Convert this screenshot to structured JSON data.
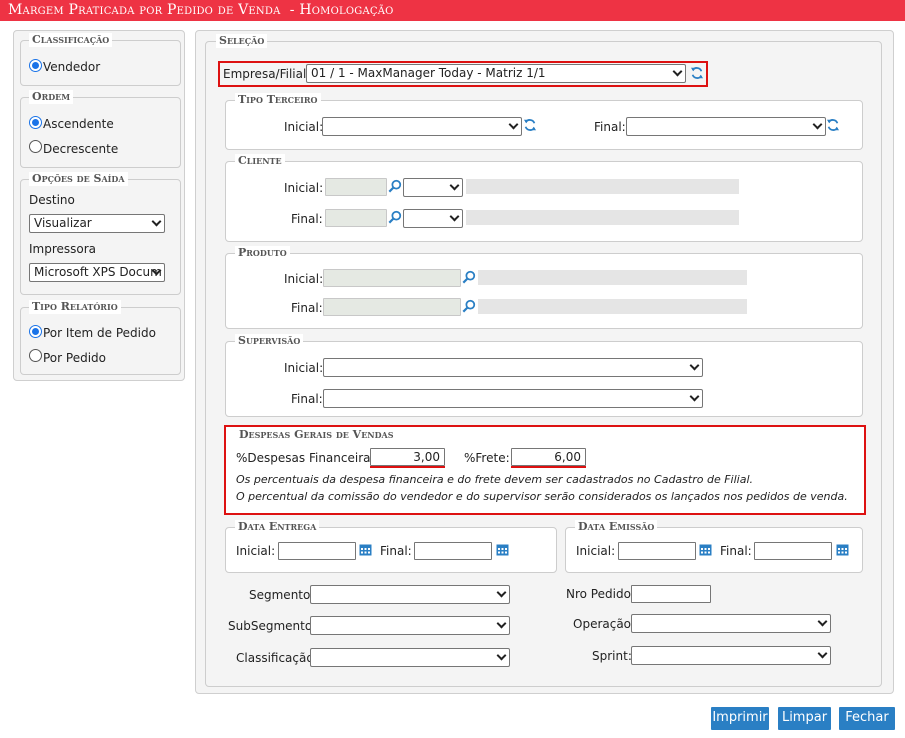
{
  "window": {
    "title": "Margem Praticada por Pedido de Venda  - Homologação"
  },
  "left": {
    "classificacao": {
      "legend": "Classificação",
      "options": [
        "Vendedor"
      ]
    },
    "ordem": {
      "legend": "Ordem",
      "options": [
        "Ascendente",
        "Decrescente"
      ]
    },
    "saida": {
      "legend": "Opções de Saída",
      "destino_label": "Destino",
      "destino_value": "Visualizar",
      "impressora_label": "Impressora",
      "impressora_value": "Microsoft XPS Docum"
    },
    "tipo": {
      "legend": "Tipo Relatório",
      "options": [
        "Por Item de Pedido",
        "Por Pedido"
      ]
    }
  },
  "selecao": {
    "legend": "Seleção",
    "empresa_label": "Empresa/Filial:",
    "empresa_value": "01 / 1 - MaxManager Today - Matriz 1/1",
    "tipo_terceiro": {
      "legend": "Tipo Terceiro",
      "inicial": "Inicial:",
      "final": "Final:"
    },
    "cliente": {
      "legend": "Cliente",
      "inicial": "Inicial:",
      "final": "Final:"
    },
    "produto": {
      "legend": "Produto",
      "inicial": "Inicial:",
      "final": "Final:"
    },
    "supervisao": {
      "legend": "Supervisão",
      "inicial": "Inicial:",
      "final": "Final:"
    },
    "despesas": {
      "legend": "Despesas Gerais de Vendas",
      "fin_label": "%Despesas Financeiras:",
      "fin_value": "3,00",
      "frete_label": "%Frete:",
      "frete_value": "6,00",
      "note1": "Os percentuais da despesa financeira e do frete devem ser cadastrados no Cadastro de Filial.",
      "note2": "O percentual da comissão do vendedor e do supervisor serão considerados os lançados nos pedidos de venda."
    },
    "data_entrega": {
      "legend": "Data Entrega",
      "inicial": "Inicial:",
      "final": "Final:"
    },
    "data_emissao": {
      "legend": "Data Emissão",
      "inicial": "Inicial:",
      "final": "Final:"
    },
    "segmento": "Segmento:",
    "subsegmento": "SubSegmento:",
    "classificacao": "Classificação:",
    "nro_pedido": "Nro Pedido:",
    "operacao": "Operação:",
    "sprint": "Sprint:"
  },
  "buttons": {
    "imprimir": "Imprimir",
    "limpar": "Limpar",
    "fechar": "Fechar"
  },
  "colors": {
    "title_bar": "#ee3344",
    "accent": "#2a7fc4",
    "highlight": "#dd1111"
  }
}
